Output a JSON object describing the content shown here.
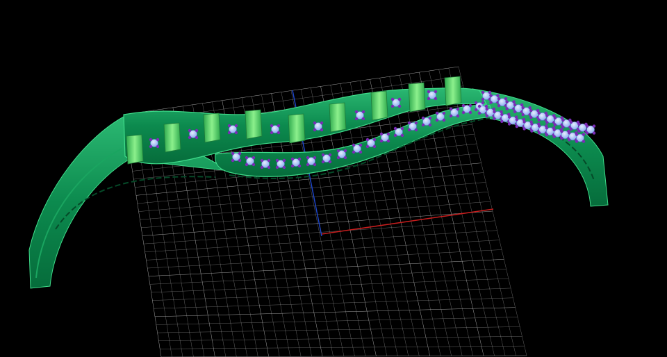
{
  "viewport": {
    "background": "#000000",
    "grid_color": "#b4b4b4",
    "x_axis_color": "#c81e1e",
    "z_axis_color": "#1e46c8"
  },
  "model": {
    "metal_color": "#0c8a4e",
    "metal_highlight": "#3fdc8a",
    "metal_edge": "#1aa560",
    "bar_color": "#4ed468",
    "gem_color": "#9fc0f5",
    "prong_color": "#7a2bb6"
  }
}
